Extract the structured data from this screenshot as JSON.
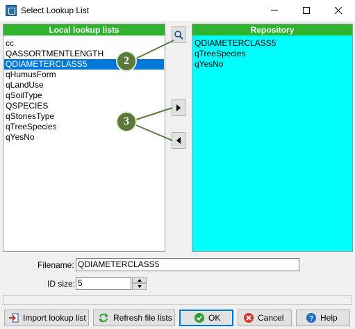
{
  "window": {
    "title": "Select Lookup List",
    "controls": {
      "minimize": "minimize",
      "maximize": "maximize",
      "close": "close"
    }
  },
  "local_panel": {
    "header": "Local lookup lists",
    "items": [
      "cc",
      "QASSORTMENTLENGTH",
      "QDIAMETERCLASS5",
      "qHumusForm",
      "qLandUse",
      "qSoilType",
      "QSPECIES",
      "qStonesType",
      "qTreeSpecies",
      "qYesNo"
    ],
    "selected_index": 2
  },
  "repo_panel": {
    "header": "Repository",
    "items": [
      "QDIAMETERCLASS5",
      "qTreeSpecies",
      "qYesNo"
    ]
  },
  "callouts": {
    "one": "2",
    "two": "3"
  },
  "form": {
    "filename_label": "Filename:",
    "filename_value": "QDIAMETERCLASS5",
    "idsize_label": "ID size:",
    "idsize_value": "5"
  },
  "buttons": {
    "import": "Import lookup list",
    "refresh": "Refresh file lists",
    "ok": "OK",
    "cancel": "Cancel",
    "help": "Help"
  },
  "colors": {
    "header_green": "#2fb32f",
    "repo_background": "#00ffff",
    "selection_blue": "#0078d7",
    "callout_green": "#5a7a3c"
  }
}
